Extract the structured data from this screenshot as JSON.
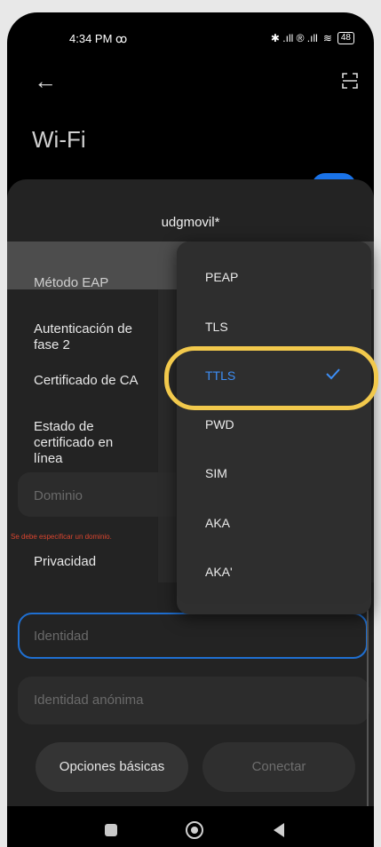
{
  "status_bar": {
    "time": "4:34 PM",
    "voicemail": "ꝏ",
    "icons": "✱ .ıll ® .ıll",
    "battery": "48"
  },
  "header": {
    "title": "Wi-Fi"
  },
  "dialog": {
    "network_name": "udgmovil*",
    "eap_method_label": "Método EAP",
    "phase2_auth_label": "Autenticación de fase 2",
    "ca_cert_label": "Certificado de CA",
    "online_cert_status_label": "Estado de certificado en línea",
    "domain_placeholder": "Dominio",
    "domain_error": "Se debe especificar un dominio.",
    "privacy_label": "Privacidad",
    "identity_placeholder": "Identidad",
    "anon_identity_placeholder": "Identidad anónima",
    "basic_options_button": "Opciones básicas",
    "connect_button": "Conectar"
  },
  "eap_dropdown": {
    "options": [
      "PEAP",
      "TLS",
      "TTLS",
      "PWD",
      "SIM",
      "AKA",
      "AKA'"
    ],
    "selected": "TTLS"
  },
  "colors": {
    "accent": "#3d8ef5",
    "highlight": "#f2c94c",
    "error": "#d9452f"
  }
}
